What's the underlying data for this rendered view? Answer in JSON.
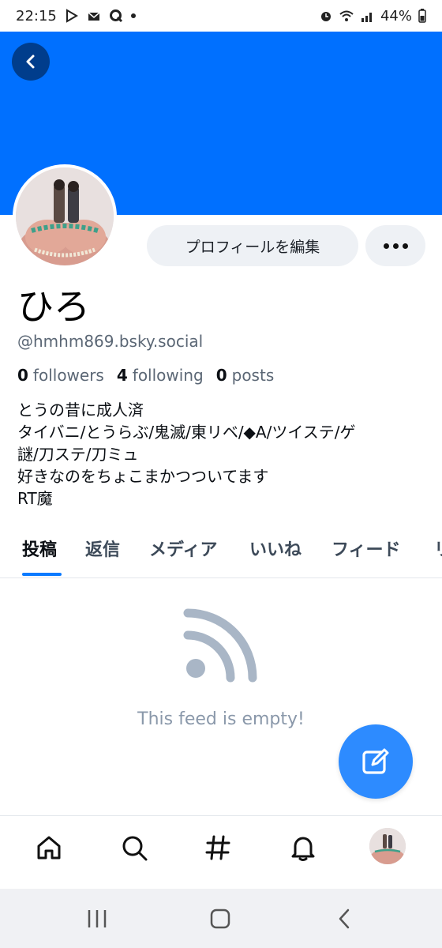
{
  "status_bar": {
    "time": "22:15",
    "battery": "44%"
  },
  "profile": {
    "display_name": "ひろ",
    "handle": "@hmhm869.bsky.social",
    "followers_count": "0",
    "followers_label": "followers",
    "following_count": "4",
    "following_label": "following",
    "posts_count": "0",
    "posts_label": "posts",
    "bio_lines": [
      "とうの昔に成人済",
      "タイバニ/とうらぶ/鬼滅/東リベ/◆A/ツイステ/ゲ",
      "謎/刀ステ/刀ミュ",
      "好きなのをちょこまかつついてます",
      "RT魔"
    ]
  },
  "actions": {
    "edit_profile_label": "プロフィールを編集"
  },
  "tabs": [
    {
      "label": "投稿",
      "active": true
    },
    {
      "label": "返信",
      "active": false
    },
    {
      "label": "メディア",
      "active": false
    },
    {
      "label": "いいね",
      "active": false
    },
    {
      "label": "フィード",
      "active": false
    },
    {
      "label": "リ",
      "active": false
    }
  ],
  "feed": {
    "empty_text": "This feed is empty!"
  },
  "colors": {
    "banner": "#0070ff",
    "accent": "#0a7aff",
    "fab": "#2d8bff"
  },
  "icons": {
    "back": "chevron-left-icon",
    "more": "more-horizontal-icon",
    "feed_empty": "rss-icon",
    "compose": "compose-icon",
    "nav": [
      "home-icon",
      "search-icon",
      "hashtag-icon",
      "bell-icon",
      "profile-avatar"
    ]
  }
}
